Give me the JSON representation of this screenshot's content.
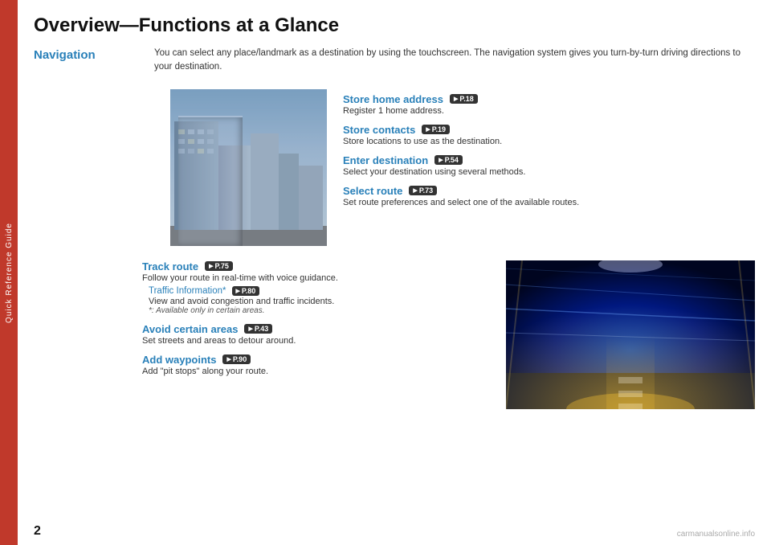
{
  "sidebar": {
    "label": "Quick Reference Guide"
  },
  "page": {
    "title": "Overview—Functions at a Glance",
    "number": "2"
  },
  "navigation": {
    "label": "Navigation",
    "description": "You can select any place/landmark as a destination by using the touchscreen. The navigation system gives you turn-by-turn driving directions to your destination."
  },
  "features_top": [
    {
      "title": "Store home address",
      "page_ref": "P.18",
      "description": "Register 1 home address."
    },
    {
      "title": "Store contacts",
      "page_ref": "P.19",
      "description": "Store locations to use as the destination."
    },
    {
      "title": "Enter destination",
      "page_ref": "P.54",
      "description": "Select your destination using several methods."
    },
    {
      "title": "Select route",
      "page_ref": "P.73",
      "description": "Set route preferences and select one of the available routes."
    }
  ],
  "features_bottom": [
    {
      "title": "Track route",
      "page_ref": "P.75",
      "description": "Follow your route in real-time with voice guidance.",
      "sub_feature": {
        "title": "Traffic Information*",
        "page_ref": "P.80",
        "description": "View and avoid congestion and traffic incidents.",
        "note": "*: Available only in certain areas."
      }
    },
    {
      "title": "Avoid certain areas",
      "page_ref": "P.43",
      "description": "Set streets and areas to detour around."
    },
    {
      "title": "Add waypoints",
      "page_ref": "P.90",
      "description": "Add \"pit stops\" along your route."
    }
  ],
  "watermark": "carmanualsonline.info"
}
